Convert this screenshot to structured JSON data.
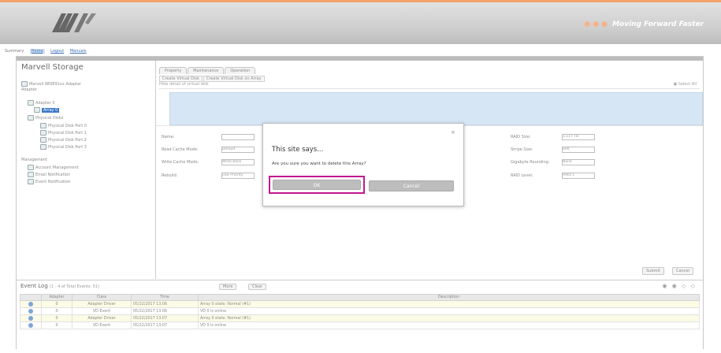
{
  "header": {
    "logo_sub": "",
    "slogan_dot": "● ● ●",
    "slogan": "Moving Forward Faster"
  },
  "links": [
    "Summary",
    "Home",
    "Logout",
    "Manuals"
  ],
  "right_mark": "",
  "app_title": "Marvell Storage",
  "tree": [
    {
      "text": "Marvell 88SE91xx Adapter",
      "indent": 0
    },
    {
      "text": "Adapter",
      "indent": 0
    },
    {
      "text": "Adapter 0",
      "indent": 1
    },
    {
      "text": "Array 0",
      "indent": 2,
      "selected": true
    },
    {
      "text": "Physical Disks",
      "indent": 1
    },
    {
      "text": "Physical Disk Port 0",
      "indent": 2
    },
    {
      "text": "Physical Disk Port 1",
      "indent": 2
    },
    {
      "text": "Physical Disk Port 2",
      "indent": 2
    },
    {
      "text": "Physical Disk Port 3",
      "indent": 2
    },
    {
      "text": "Management",
      "indent": 0
    },
    {
      "text": "Account Management",
      "indent": 1
    },
    {
      "text": "Email Notification",
      "indent": 1
    },
    {
      "text": "Event Notification",
      "indent": 1
    }
  ],
  "main": {
    "tabs": [
      "Property",
      "Maintenance",
      "Operation"
    ],
    "subtabs": [
      "Create Virtual Disk",
      "Create Virtual Disk on Array"
    ],
    "toolbar_left": "Hide detail of virtual disk",
    "toolbar_right": "▣ Select All",
    "fields_left": [
      {
        "label": "Name:",
        "value": ""
      },
      {
        "label": "Read Cache Mode:",
        "value": "Default"
      },
      {
        "label": "Write Cache Mode:",
        "value": "Write Back"
      },
      {
        "label": "Rebuild:",
        "value": "Low Priority"
      }
    ],
    "fields_right": [
      {
        "label": "RAID Size:",
        "value": "1.117 TB"
      },
      {
        "label": "Stripe Size:",
        "value": "64K"
      },
      {
        "label": "Gigabyte Rounding:",
        "value": "None"
      },
      {
        "label": "RAID Level:",
        "value": "RAID 1"
      }
    ],
    "buttons": [
      "Submit",
      "Cancel"
    ]
  },
  "dialog": {
    "close": "×",
    "title": "This site says...",
    "message": "Are you sure you want to delete this Array?",
    "ok": "OK",
    "cancel": "Cancel"
  },
  "bottom": {
    "title": "Event Log",
    "subtitle": "(1 - 4 of Total Events: 51)",
    "buttons": [
      "More",
      "Clear"
    ],
    "icons": "◉ ◉ ◇ ◇",
    "columns": [
      "",
      "Adapter",
      "Class",
      "Time",
      "Description"
    ],
    "rows": [
      {
        "adapter": "0",
        "class": "Adapter Driver",
        "time": "05/22/2017 13:06",
        "desc": "Array 0 state: Normal (#1)"
      },
      {
        "adapter": "0",
        "class": "VD Event",
        "time": "05/22/2017 13:06",
        "desc": "VD 0 is online"
      },
      {
        "adapter": "0",
        "class": "Adapter Driver",
        "time": "05/22/2017 13:07",
        "desc": "Array 0 state: Normal (#1)"
      },
      {
        "adapter": "0",
        "class": "VD Event",
        "time": "05/22/2017 13:07",
        "desc": "VD 0 is online"
      }
    ]
  }
}
